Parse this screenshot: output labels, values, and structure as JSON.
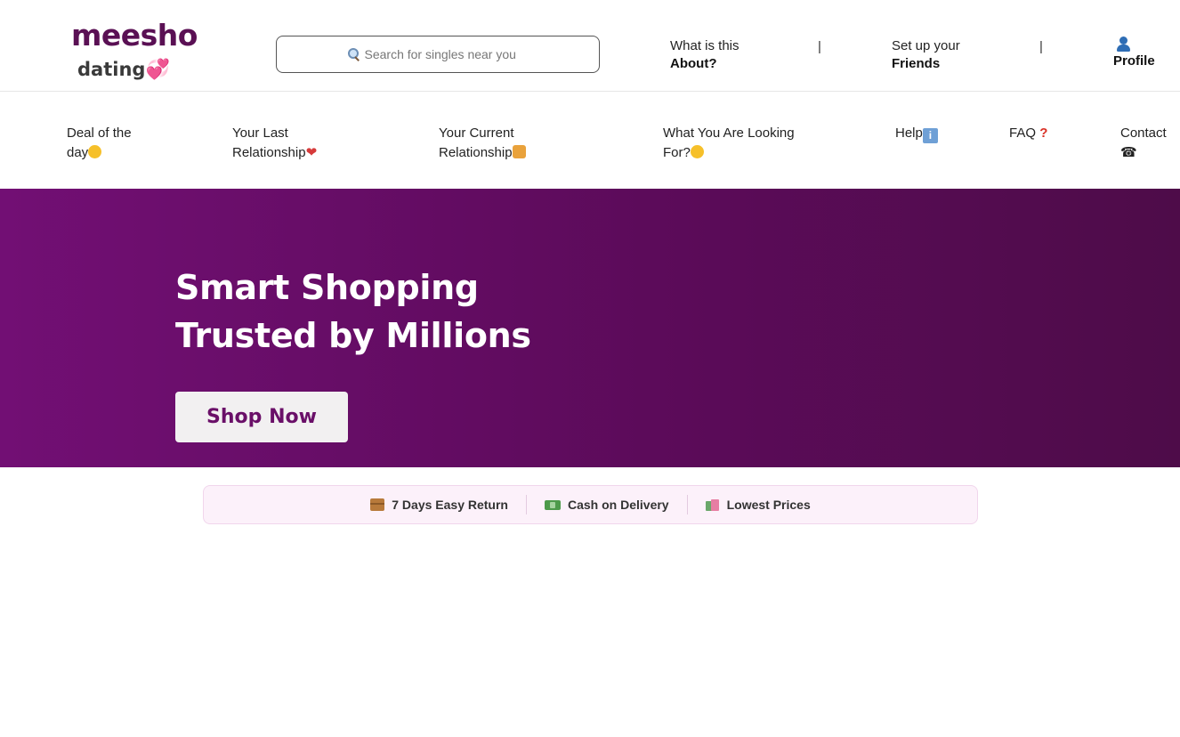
{
  "header": {
    "logo_main": "meesho",
    "logo_sub": "dating",
    "logo_emoji": "💞",
    "search_placeholder": "Search for singles near you",
    "about_line1": "What is this",
    "about_line2": "About?",
    "friends_line1": "Set up your",
    "friends_line2": "Friends",
    "separator": "|",
    "profile_label": "Profile"
  },
  "nav": {
    "items": [
      {
        "line1": "Deal of the",
        "line2": "day",
        "icon": "smiley-icon"
      },
      {
        "line1": "Your Last",
        "line2": "Relationship",
        "icon": "broken-heart-icon"
      },
      {
        "line1": "Your Current",
        "line2": "Relationship",
        "icon": "couple-icon"
      },
      {
        "line1": "What You Are Looking",
        "line2": "For?",
        "icon": "thinking-face-icon"
      },
      {
        "line1": "Help",
        "icon": "info-icon"
      },
      {
        "line1": "FAQ",
        "icon": "question-mark-icon"
      },
      {
        "line1": "Contact",
        "icon": "phone-icon"
      }
    ]
  },
  "hero": {
    "title_line1": "Smart Shopping",
    "title_line2": "Trusted by Millions",
    "cta": "Shop Now",
    "bg_start": "#720f74",
    "bg_end": "#4e0c49"
  },
  "features": [
    {
      "label": "7 Days Easy Return",
      "icon": "package-icon"
    },
    {
      "label": "Cash on Delivery",
      "icon": "cash-icon"
    },
    {
      "label": "Lowest Prices",
      "icon": "shopping-bags-icon"
    }
  ],
  "colors": {
    "brand": "#5a1054",
    "accent": "#6a0f68"
  }
}
